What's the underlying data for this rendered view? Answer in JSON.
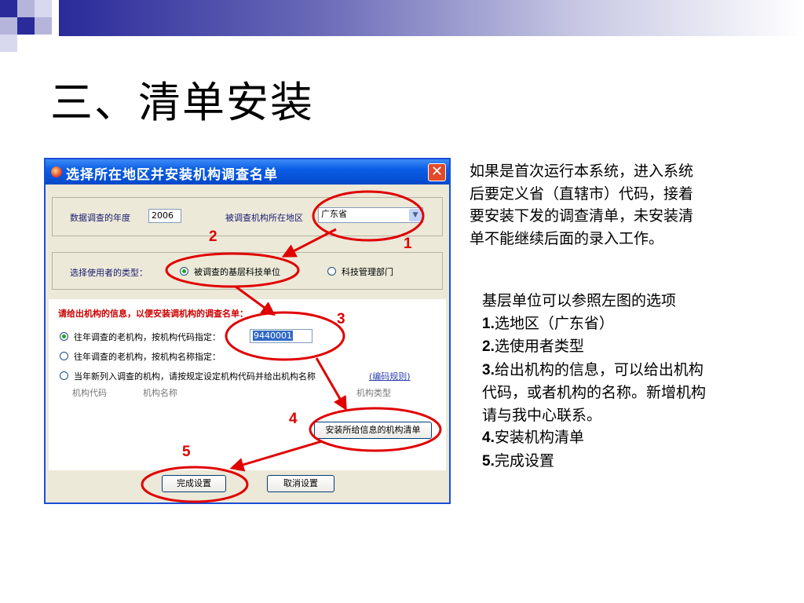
{
  "slide_title": "三、清单安装",
  "dialog": {
    "title": "选择所在地区并安装机构调查名单",
    "close_glyph": "✕",
    "year_label": "数据调查的年度",
    "year_value": "2006",
    "region_label": "被调查机构所在地区",
    "region_value": "广东省",
    "user_type_label": "选择使用者的类型：",
    "user_type_options": [
      "被调查的基层科技单位",
      "科技管理部门"
    ],
    "org_info_heading": "请给出机构的信息，以便安装调机构的调查名单：",
    "org_options": [
      "往年调查的老机构，按机构代码指定：",
      "往年调查的老机构，按机构名称指定：",
      "当年新列入调查的机构，请按规定设定机构代码并给出机构名称"
    ],
    "org_code_value": "9440001",
    "encoding_rule_link": "(编码规则)",
    "column_headers": [
      "机构代码",
      "机构名称",
      "机构类型"
    ],
    "install_button": "安装所给信息的机构清单",
    "finish_button": "完成设置",
    "cancel_button": "取消设置"
  },
  "markers": [
    "1",
    "2",
    "3",
    "4",
    "5"
  ],
  "description": {
    "intro_lines": [
      "如果是首次运行本系统，进入系统",
      "后要定义省（直辖市）代码，接着",
      "要安装下发的调查清单，未安装清",
      "单不能继续后面的录入工作。"
    ],
    "steps_heading": "基层单位可以参照左图的选项",
    "steps": [
      {
        "num": "1.",
        "text": "选地区（广东省）"
      },
      {
        "num": "2.",
        "text": "选使用者类型"
      },
      {
        "num": "3.",
        "text": "给出机构的信息，可以给出机构"
      },
      {
        "num": "",
        "text": "代码，或者机构的名称。新增机构"
      },
      {
        "num": "",
        "text": "请与我中心联系。"
      },
      {
        "num": "4.",
        "text": "安装机构清单"
      },
      {
        "num": "5.",
        "text": "完成设置"
      }
    ]
  },
  "colors": {
    "annotation_red": "#e00000",
    "title_bar_blue": "#0a5ee6"
  }
}
